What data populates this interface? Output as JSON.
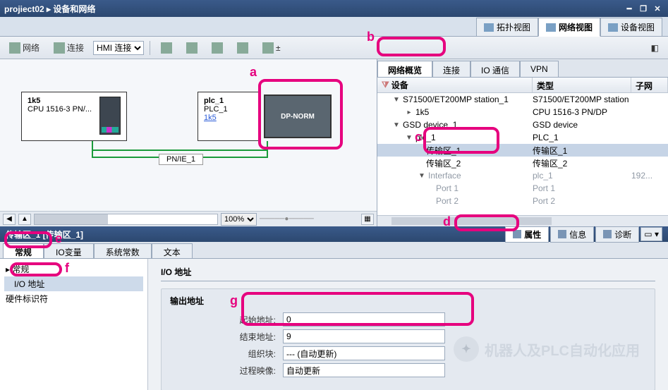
{
  "title": {
    "breadcrumb": "projiect02  ▸  设备和网络"
  },
  "topTabs": {
    "topo": "拓扑视图",
    "net": "网络视图",
    "dev": "设备视图"
  },
  "toolbar": {
    "net": "网络",
    "conn": "连接",
    "connType": "HMI 连接"
  },
  "canvas": {
    "dev1": {
      "name": "1k5",
      "type": "CPU 1516-3 PN/..."
    },
    "dev2": {
      "name": "plc_1",
      "type": "PLC_1",
      "link": "1k5"
    },
    "dpnorm": "DP-NORM",
    "netName": "PN/IE_1",
    "zoom": "100%"
  },
  "rightTabs": {
    "overview": "网络概览",
    "conn": "连接",
    "io": "IO 通信",
    "vpn": "VPN"
  },
  "treeHead": {
    "dev": "设备",
    "type": "类型",
    "subnet": "子网"
  },
  "tree": {
    "r1": {
      "c1": "S71500/ET200MP station_1",
      "c2": "S71500/ET200MP station"
    },
    "r2": {
      "c1": "1k5",
      "c2": "CPU 1516-3 PN/DP"
    },
    "r3": {
      "c1": "GSD device_1",
      "c2": "GSD device"
    },
    "r4": {
      "c1": "plc_1",
      "c2": "PLC_1"
    },
    "r5": {
      "c1": "传输区_1",
      "c2": "传输区_1"
    },
    "r6": {
      "c1": "传输区_2",
      "c2": "传输区_2"
    },
    "r7": {
      "c1": "Interface",
      "c2": "plc_1",
      "c3": "192..."
    },
    "r8": {
      "c1": "Port 1",
      "c2": "Port 1"
    },
    "r9": {
      "c1": "Port 2",
      "c2": "Port 2"
    }
  },
  "selTitle": "传输区_1 [传输区_1]",
  "propTabs": {
    "prop": "属性",
    "info": "信息",
    "diag": "诊断"
  },
  "lowerTabs": {
    "gen": "常规",
    "io": "IO变量",
    "sys": "系统常数",
    "text": "文本"
  },
  "lnav": {
    "gen": "常规",
    "ioaddr": "I/O 地址",
    "hwid": "硬件标识符"
  },
  "form": {
    "sect": "I/O 地址",
    "outTitle": "输出地址",
    "startLabel": "起始地址:",
    "startVal": "0",
    "endLabel": "结束地址:",
    "endVal": "9",
    "obLabel": "组织块:",
    "obVal": "--- (自动更新)",
    "piLabel": "过程映像:",
    "piVal": "自动更新"
  },
  "annotations": {
    "a": "a",
    "b": "b",
    "c": "c",
    "d": "d",
    "e": "e",
    "f": "f",
    "g": "g"
  },
  "watermark": "机器人及PLC自动化应用"
}
